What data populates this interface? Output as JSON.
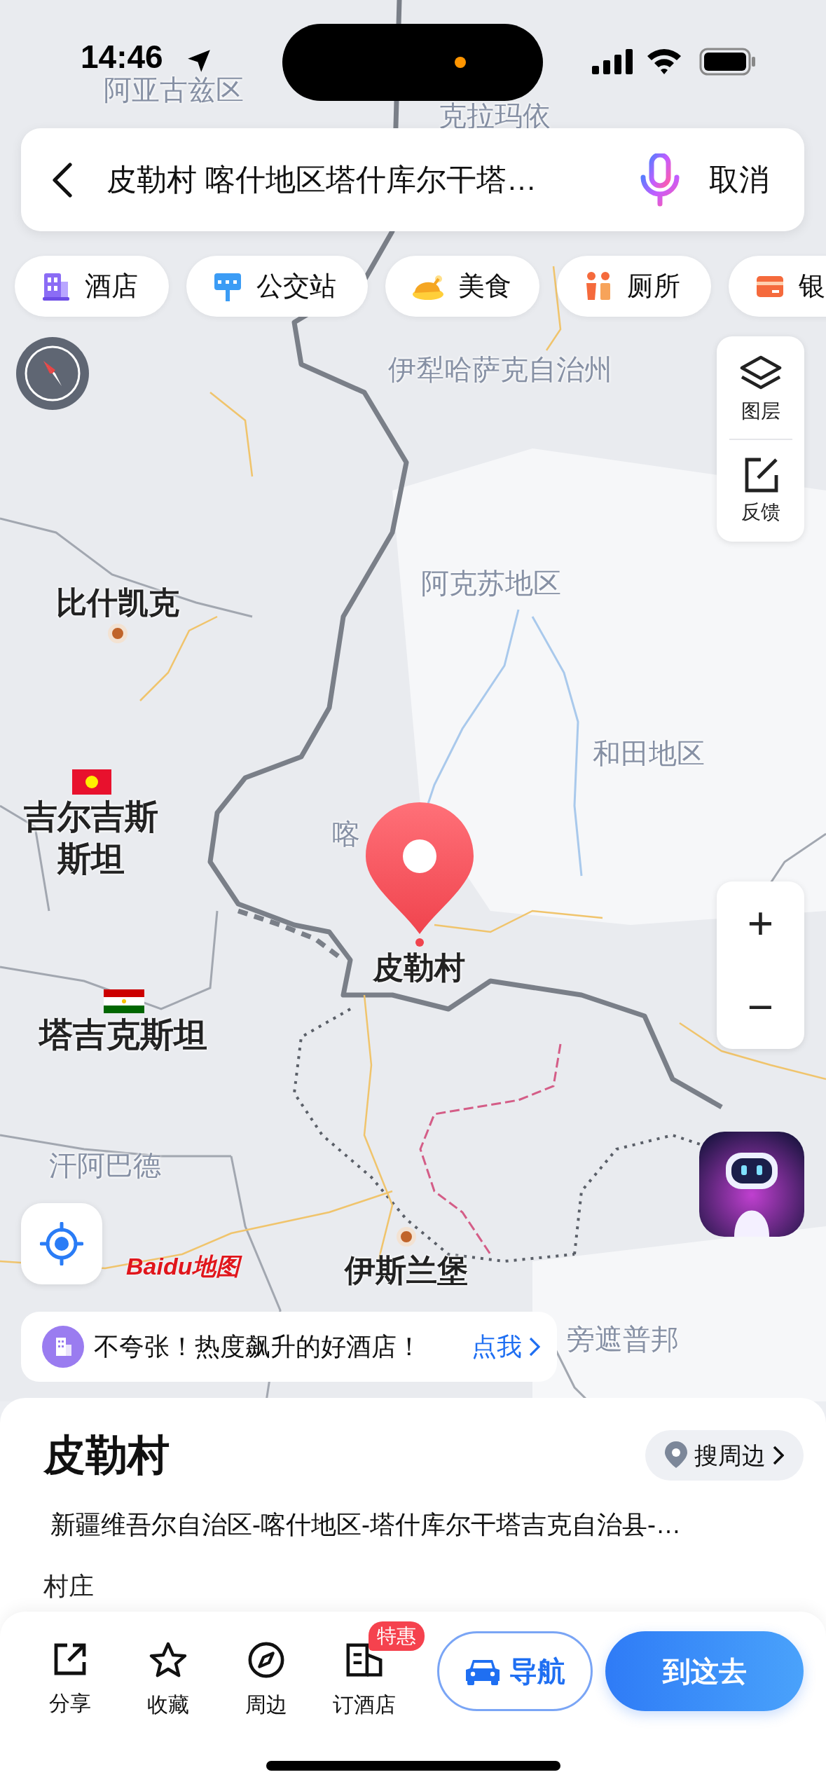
{
  "status_bar": {
    "time": "14:46"
  },
  "search_bar": {
    "query": "皮勒村 喀什地区塔什库尔干塔…",
    "cancel": "取消"
  },
  "categories": [
    {
      "label": "酒店",
      "kind": "hotel"
    },
    {
      "label": "公交站",
      "kind": "bus"
    },
    {
      "label": "美食",
      "kind": "food"
    },
    {
      "label": "厕所",
      "kind": "toilet"
    },
    {
      "label": "银",
      "kind": "bank"
    }
  ],
  "map_controls": {
    "layers": "图层",
    "feedback": "反馈",
    "zoom_in": "+",
    "zoom_out": "−"
  },
  "map_labels": [
    {
      "text": "阿亚古兹区",
      "kind": "area"
    },
    {
      "text": "克拉玛依",
      "kind": "area"
    },
    {
      "text": "伊犁哈萨克自治州",
      "kind": "area"
    },
    {
      "text": "比什凯克",
      "kind": "city"
    },
    {
      "text": "阿克苏地区",
      "kind": "area"
    },
    {
      "text": "和田地区",
      "kind": "area"
    },
    {
      "text": "吉尔吉斯斯坦",
      "kind": "country"
    },
    {
      "text": "喀",
      "kind": "area"
    },
    {
      "text": "皮勒村",
      "kind": "selected"
    },
    {
      "text": "塔吉克斯坦",
      "kind": "country"
    },
    {
      "text": "汗阿巴德",
      "kind": "area"
    },
    {
      "text": "伊斯兰堡",
      "kind": "city"
    },
    {
      "text": "旁遮普邦",
      "kind": "area"
    }
  ],
  "map_logo": "Baidu地图",
  "promo": {
    "text": "不夸张！热度飙升的好酒店！",
    "link": "点我"
  },
  "place": {
    "name": "皮勒村",
    "nearby": "搜周边",
    "address": "新疆维吾尔自治区-喀什地区-塔什库尔干塔吉克自治县-…",
    "type": "村庄"
  },
  "actions": [
    {
      "label": "分享",
      "kind": "share"
    },
    {
      "label": "收藏",
      "kind": "favorite"
    },
    {
      "label": "周边",
      "kind": "nearby"
    },
    {
      "label": "订酒店",
      "kind": "hotel",
      "badge": "特惠"
    }
  ],
  "navigate": "导航",
  "go": "到这去"
}
